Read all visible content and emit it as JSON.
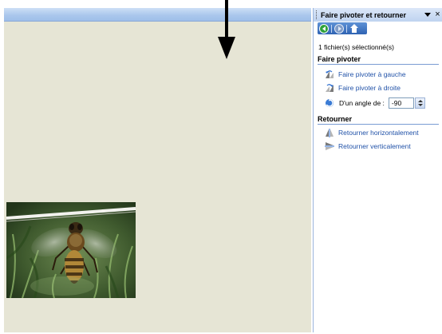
{
  "task_pane": {
    "title": "Faire pivoter et retourner",
    "close_glyph": "×",
    "navigation": {
      "back_icon": "back-arrow-icon",
      "forward_icon": "forward-arrow-icon",
      "home_icon": "home-icon"
    },
    "selection_status": "1 fichier(s) sélectionné(s)",
    "rotate_section": {
      "title": "Faire pivoter",
      "rotate_left_label": "Faire pivoter à gauche",
      "rotate_right_label": "Faire pivoter à droite",
      "angle_label": "D'un angle de :",
      "angle_value": "-90"
    },
    "flip_section": {
      "title": "Retourner",
      "flip_horizontal_label": "Retourner horizontalement",
      "flip_vertical_label": "Retourner verticalement"
    }
  },
  "canvas": {
    "thumbnail_subject": "bee-photo"
  },
  "colors": {
    "canvas_background": "#e6e5d5",
    "link_text": "#2152a8",
    "header_gradient_top": "#dbe7f8",
    "nav_strip": "#2f63b3",
    "section_rule": "#7a9cd3"
  }
}
